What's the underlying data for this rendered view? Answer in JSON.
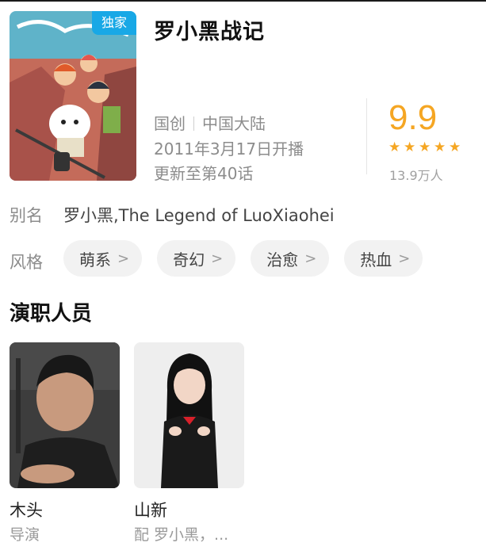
{
  "badge": "独家",
  "title": "罗小黑战记",
  "meta": {
    "origin": "国创",
    "region": "中国大陆",
    "premiere": "2011年3月17日开播",
    "update": "更新至第40话"
  },
  "rating": {
    "score": "9.9",
    "stars": 5,
    "count": "13.9万人",
    "star_color": "#f5a623"
  },
  "alias": {
    "label": "别名",
    "value": "罗小黑,The Legend of LuoXiaohei"
  },
  "style": {
    "label": "风格",
    "tags": [
      "萌系",
      "奇幻",
      "治愈",
      "热血"
    ]
  },
  "cast": {
    "title": "演职人员",
    "people": [
      {
        "name": "木头",
        "role": "导演"
      },
      {
        "name": "山新",
        "role": "配 罗小黑，..."
      }
    ]
  },
  "icons": {
    "chevron": "chevron-right-icon",
    "star": "star-icon"
  }
}
